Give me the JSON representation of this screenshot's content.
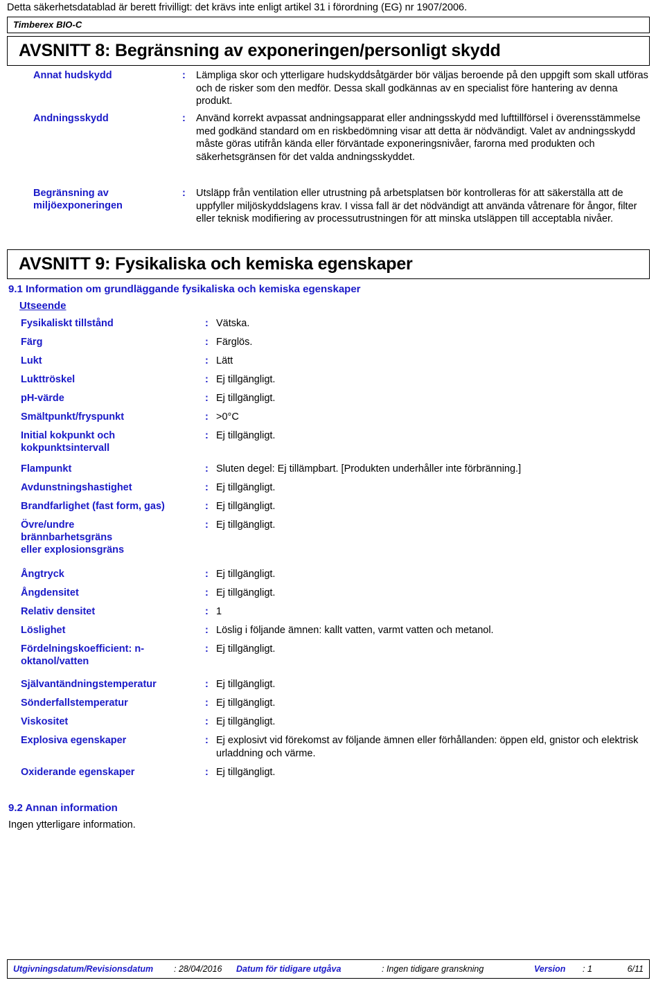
{
  "header": {
    "disclaimer": "Detta säkerhetsdatablad är berett frivilligt: det krävs inte enligt artikel 31 i förordning (EG) nr 1907/2006.",
    "product_name": "Timberex BIO-C",
    "label_color": "#1a1ac8"
  },
  "section8": {
    "title": "AVSNITT 8: Begränsning av exponeringen/personligt skydd",
    "colon": ":",
    "rows": [
      {
        "label": "Annat hudskydd",
        "value": "Lämpliga skor och ytterligare hudskyddsåtgärder bör väljas beroende på den uppgift som skall utföras och de risker som den medför. Dessa skall godkännas av en specialist före hantering av denna produkt."
      },
      {
        "label": "Andningsskydd",
        "value": "Använd korrekt avpassat andningsapparat eller andningsskydd med lufttillförsel i överensstämmelse med godkänd standard om en riskbedömning visar att detta är nödvändigt.  Valet av andningsskydd måste göras utifrån kända eller förväntade exponeringsnivåer, farorna med produkten och säkerhetsgränsen för det valda andningsskyddet."
      },
      {
        "label": "Begränsning av miljöexponeringen",
        "value": "Utsläpp från ventilation eller utrustning på arbetsplatsen bör kontrolleras för att säkerställa att de uppfyller miljöskyddslagens krav.  I vissa fall är det nödvändigt att använda våtrenare för ångor, filter eller teknisk modifiering av processutrustningen för att minska utsläppen till acceptabla nivåer."
      }
    ]
  },
  "section9": {
    "title": "AVSNITT 9: Fysikaliska och kemiska egenskaper",
    "colon": ":",
    "subsection_9_1": "9.1 Information om grundläggande fysikaliska och kemiska egenskaper",
    "appearance_heading": "Utseende",
    "rows": [
      {
        "label": "Fysikaliskt tillstånd",
        "value": "Vätska."
      },
      {
        "label": "Färg",
        "value": "Färglös."
      },
      {
        "label": "Lukt",
        "value": "Lätt"
      },
      {
        "label": "Lukttröskel",
        "value": "Ej tillgängligt."
      },
      {
        "label": "pH-värde",
        "value": "Ej tillgängligt."
      },
      {
        "label": "Smältpunkt/fryspunkt",
        "value": ">0°C"
      },
      {
        "label": "Initial kokpunkt och kokpunktsintervall",
        "value": "Ej tillgängligt."
      },
      {
        "label": "Flampunkt",
        "value": "Sluten degel: Ej tillämpbart. [Produkten underhåller inte förbränning.]"
      },
      {
        "label": "Avdunstningshastighet",
        "value": "Ej tillgängligt."
      },
      {
        "label": "Brandfarlighet (fast form, gas)",
        "value": "Ej tillgängligt."
      },
      {
        "label": "Övre/undre brännbarhetsgräns eller explosionsgräns",
        "value": "Ej tillgängligt."
      },
      {
        "label": "Ångtryck",
        "value": "Ej tillgängligt."
      },
      {
        "label": "Ångdensitet",
        "value": "Ej tillgängligt."
      },
      {
        "label": "Relativ densitet",
        "value": "1"
      },
      {
        "label": "Löslighet",
        "value": "Löslig i följande ämnen: kallt vatten, varmt vatten och metanol."
      },
      {
        "label": "Fördelningskoefficient: n-oktanol/vatten",
        "value": "Ej tillgängligt."
      },
      {
        "label": "Självantändningstemperatur",
        "value": "Ej tillgängligt."
      },
      {
        "label": "Sönderfallstemperatur",
        "value": "Ej tillgängligt."
      },
      {
        "label": "Viskositet",
        "value": "Ej tillgängligt."
      },
      {
        "label": "Explosiva egenskaper",
        "value": "Ej explosivt vid förekomst av följande ämnen eller förhållanden: öppen eld, gnistor och elektrisk urladdning och värme."
      },
      {
        "label": "Oxiderande egenskaper",
        "value": "Ej tillgängligt."
      }
    ],
    "subsection_9_2": "9.2 Annan information",
    "subsection_9_2_text": "Ingen ytterligare information."
  },
  "footer": {
    "revision_label": "Utgivningsdatum/Revisionsdatum",
    "revision_value": ": 28/04/2016",
    "previous_label": "Datum för tidigare utgåva",
    "previous_value": ": Ingen tidigare granskning",
    "version_label": "Version",
    "version_value": ": 1",
    "page": "6/11"
  }
}
